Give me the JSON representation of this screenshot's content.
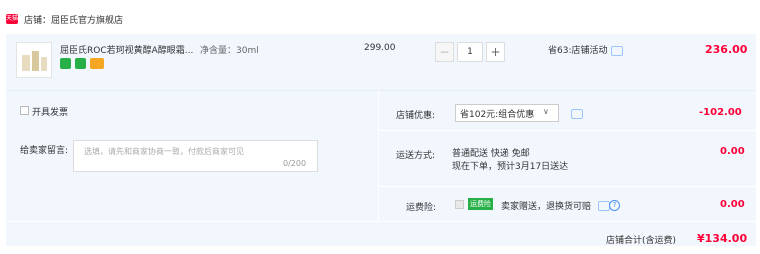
{
  "store": {
    "badge": "天猫",
    "name": "店铺：屈臣氏官方旗舰店"
  },
  "item": {
    "title": "屈臣氏ROC若珂视黄醇A醇眼霜...",
    "spec": "净含量：30ml",
    "service_icons": [
      "seven-day-return-icon",
      "guarantee-icon",
      "card-icon"
    ],
    "price": "299.00",
    "quantity": "1",
    "saved": "省63:店铺活动",
    "subtotal": "236.00"
  },
  "colors": {
    "price_red": "#ff0036",
    "row_bg": "#f2f7fe",
    "link_blue": "#4d91f5"
  },
  "options": {
    "invoice_label": "开具发票",
    "message_label": "给卖家留言:",
    "message_placeholder": "选填，请先和商家协商一致，付款后商家可见",
    "message_count": "0/200",
    "discount_label": "店铺优惠:",
    "discount_select": "省102元:组合优惠",
    "discount_amount": "-102.00",
    "shipping_label": "运送方式:",
    "shipping_line1": "普通配送 快递 免邮",
    "shipping_line2": "现在下单，预计3月17日送达",
    "shipping_amount": "0.00",
    "insurance_label": "运费险:",
    "insurance_badge": "运费险",
    "insurance_text": "卖家赠送，退换货可赔",
    "insurance_amount": "0.00"
  },
  "total": {
    "label": "店铺合计(含运费)",
    "value": "¥134.00"
  }
}
